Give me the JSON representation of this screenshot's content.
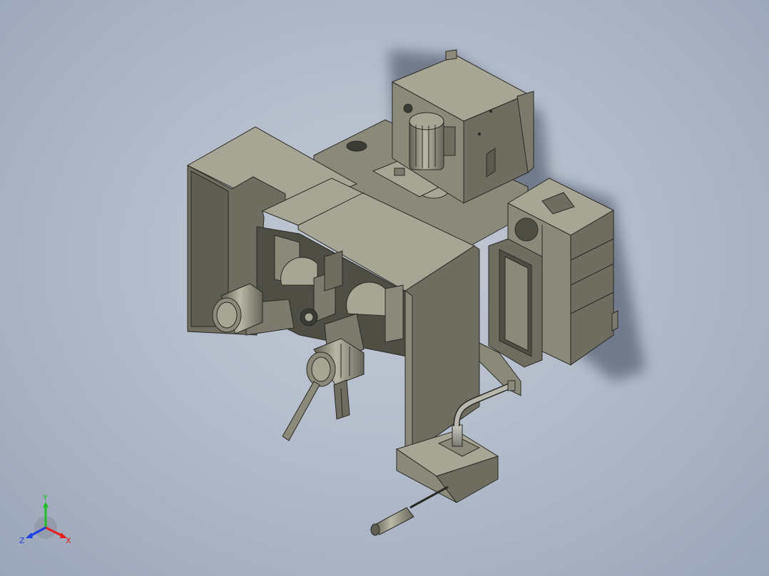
{
  "triad": {
    "x_label": "X",
    "y_label": "Y",
    "z_label": "Z",
    "x_color": "#e81e1e",
    "y_color": "#1fbf2a",
    "z_color": "#1e3ee8"
  },
  "model": {
    "body_color": "#8f8e7e",
    "face_light": "#a7a695",
    "face_mid": "#8b8a7a",
    "face_dark": "#6e6d60",
    "edge_color": "#2a2a25",
    "shadow_color": "#5c6576"
  }
}
